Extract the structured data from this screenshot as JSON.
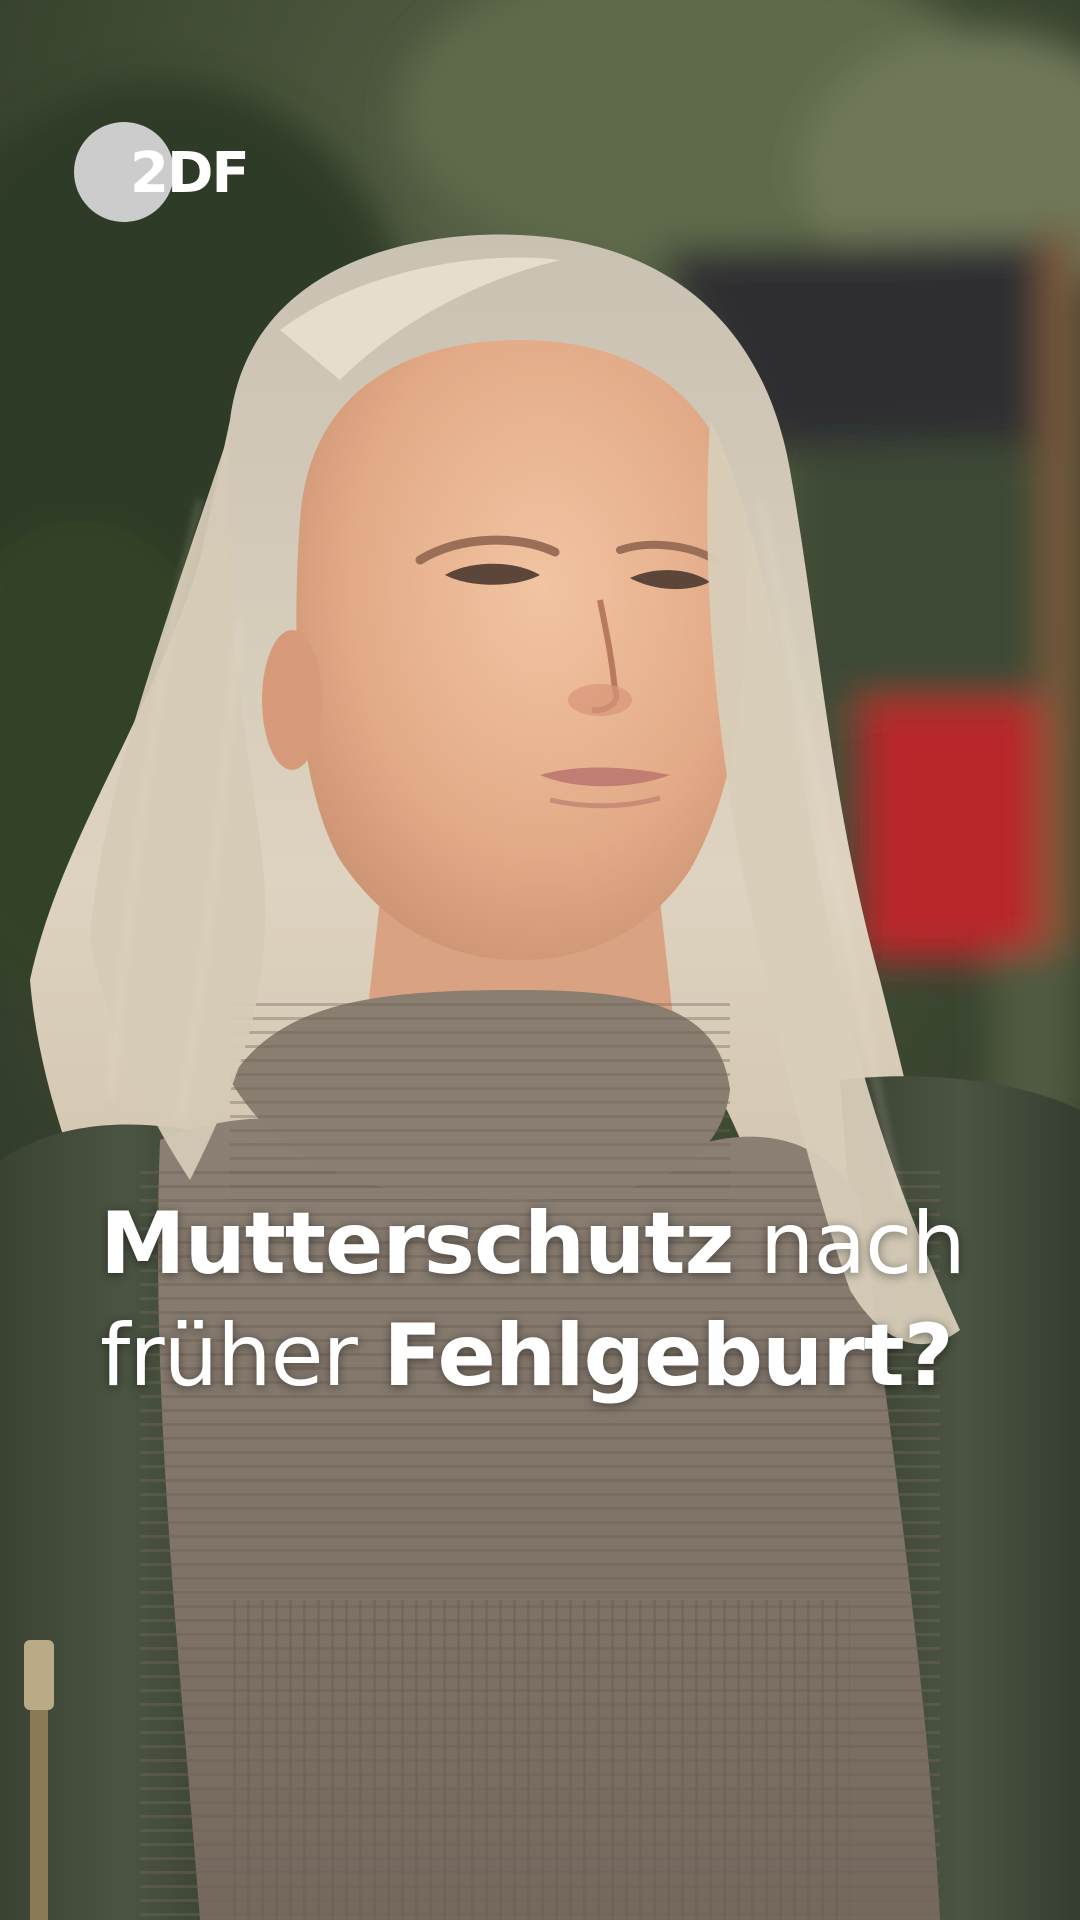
{
  "brand": {
    "logo_text": "2DF",
    "logo_color": "#e6e6e6"
  },
  "caption": {
    "line1_bold": "Mutterschutz",
    "line1_regular": "nach",
    "line2_regular": "früher",
    "line2_bold": "Fehlgeburt?"
  },
  "colors": {
    "text": "#ffffff",
    "background_foliage": "#3e4a33",
    "hair": "#d8cfbf",
    "sweater": "#85796d",
    "jacket": "#48503f",
    "play_structure_red": "#b8262a"
  }
}
